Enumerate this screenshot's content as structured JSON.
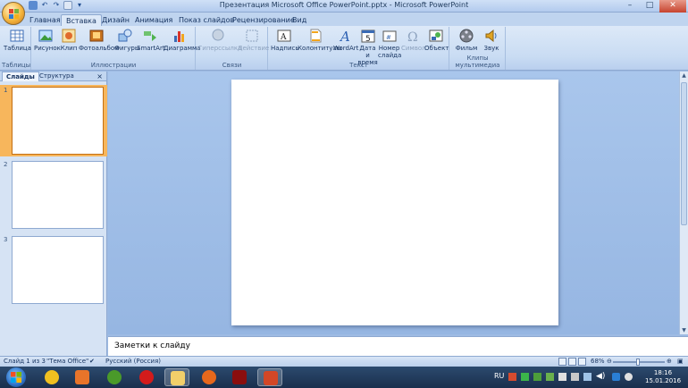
{
  "window": {
    "title": "Презентация Microsoft Office PowerPoint.pptx - Microsoft PowerPoint",
    "controls": [
      "–",
      "□",
      "✕"
    ]
  },
  "tabs": [
    "Главная",
    "Вставка",
    "Дизайн",
    "Анимация",
    "Показ слайдов",
    "Рецензирование",
    "Вид"
  ],
  "active_tab": "Вставка",
  "ribbon": {
    "groups": {
      "tables": "Таблицы",
      "illustrations": "Иллюстрации",
      "links": "Связи",
      "text": "Текст",
      "media": "Клипы мультимедиа"
    },
    "buttons": {
      "table": "Таблица",
      "picture": "Рисунок",
      "clip": "Клип",
      "photo_album": "Фотоальбом",
      "shapes": "Фигуры",
      "smartart": "SmartArt",
      "chart": "Диаграмма",
      "hyperlink": "Гиперссылка",
      "action": "Действие",
      "textbox": "Надпись",
      "header_footer": "Колонтитулы",
      "wordart": "WordArt",
      "datetime_1": "Дата и",
      "datetime_2": "время",
      "slide_number_1": "Номер",
      "slide_number_2": "слайда",
      "symbol": "Символ",
      "object": "Объект",
      "movie": "Фильм",
      "sound": "Звук"
    }
  },
  "left_pane": {
    "tabs": [
      "Слайды",
      "Структура"
    ],
    "close": "×",
    "slides": [
      "1",
      "2",
      "3"
    ]
  },
  "notes_placeholder": "Заметки к слайду",
  "statusbar": {
    "slide_info": "Слайд 1 из 3",
    "theme": "\"Тема Office\"",
    "language": "Русский (Россия)",
    "zoom": "68%"
  },
  "taskbar": {
    "language": "RU",
    "time": "18:16",
    "date": "15.01.2016"
  },
  "colors": {
    "ribbon_blue": "#c9dcf3",
    "slide_area": "#9ebbe3",
    "selected_thumb": "#f7b65c"
  }
}
